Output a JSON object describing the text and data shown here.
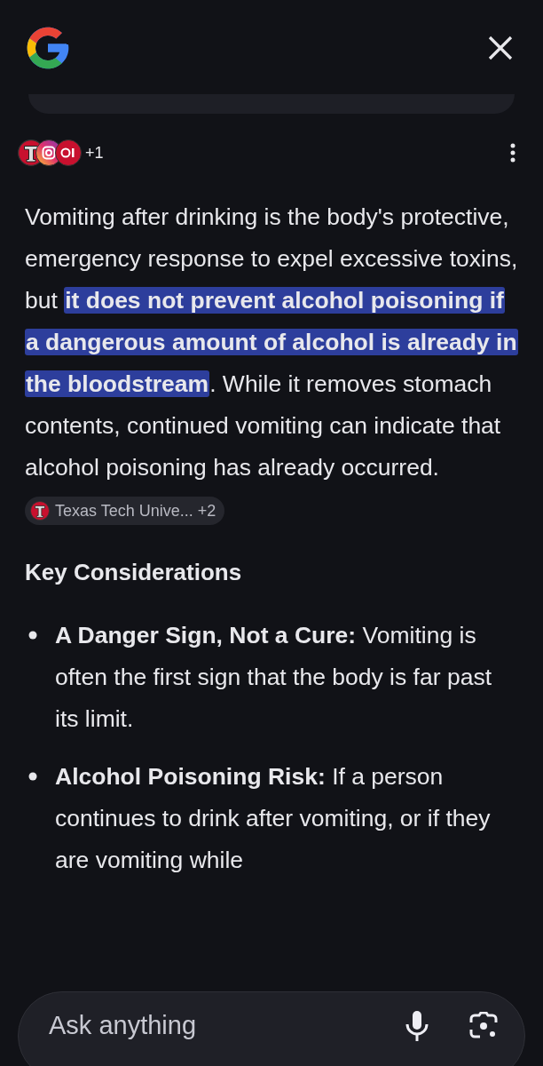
{
  "sources": {
    "more": "+1"
  },
  "answer": [
    {
      "text": "Vomiting after drinking is the body's protective, emergency response to expel excessive toxins, but ",
      "highlighted": false
    },
    {
      "text": "it does not prevent alcohol poisoning if a dangerous amount of alcohol is already in the bloodstream",
      "highlighted": true
    },
    {
      "text": ". While it removes stomach contents, continued vomiting can indicate that alcohol poisoning has already occurred.",
      "highlighted": false
    }
  ],
  "citation": {
    "label": "Texas Tech Unive...",
    "more": "+2"
  },
  "heading": "Key Considerations",
  "bullets": [
    "**A Danger Sign, Not a Cure:** Vomiting is often the first sign that the body is far past its limit.",
    "**Alcohol Poisoning Risk:** If a person continues to drink after vomiting, or if they are vomiting while"
  ],
  "input": {
    "placeholder": "Ask anything"
  }
}
